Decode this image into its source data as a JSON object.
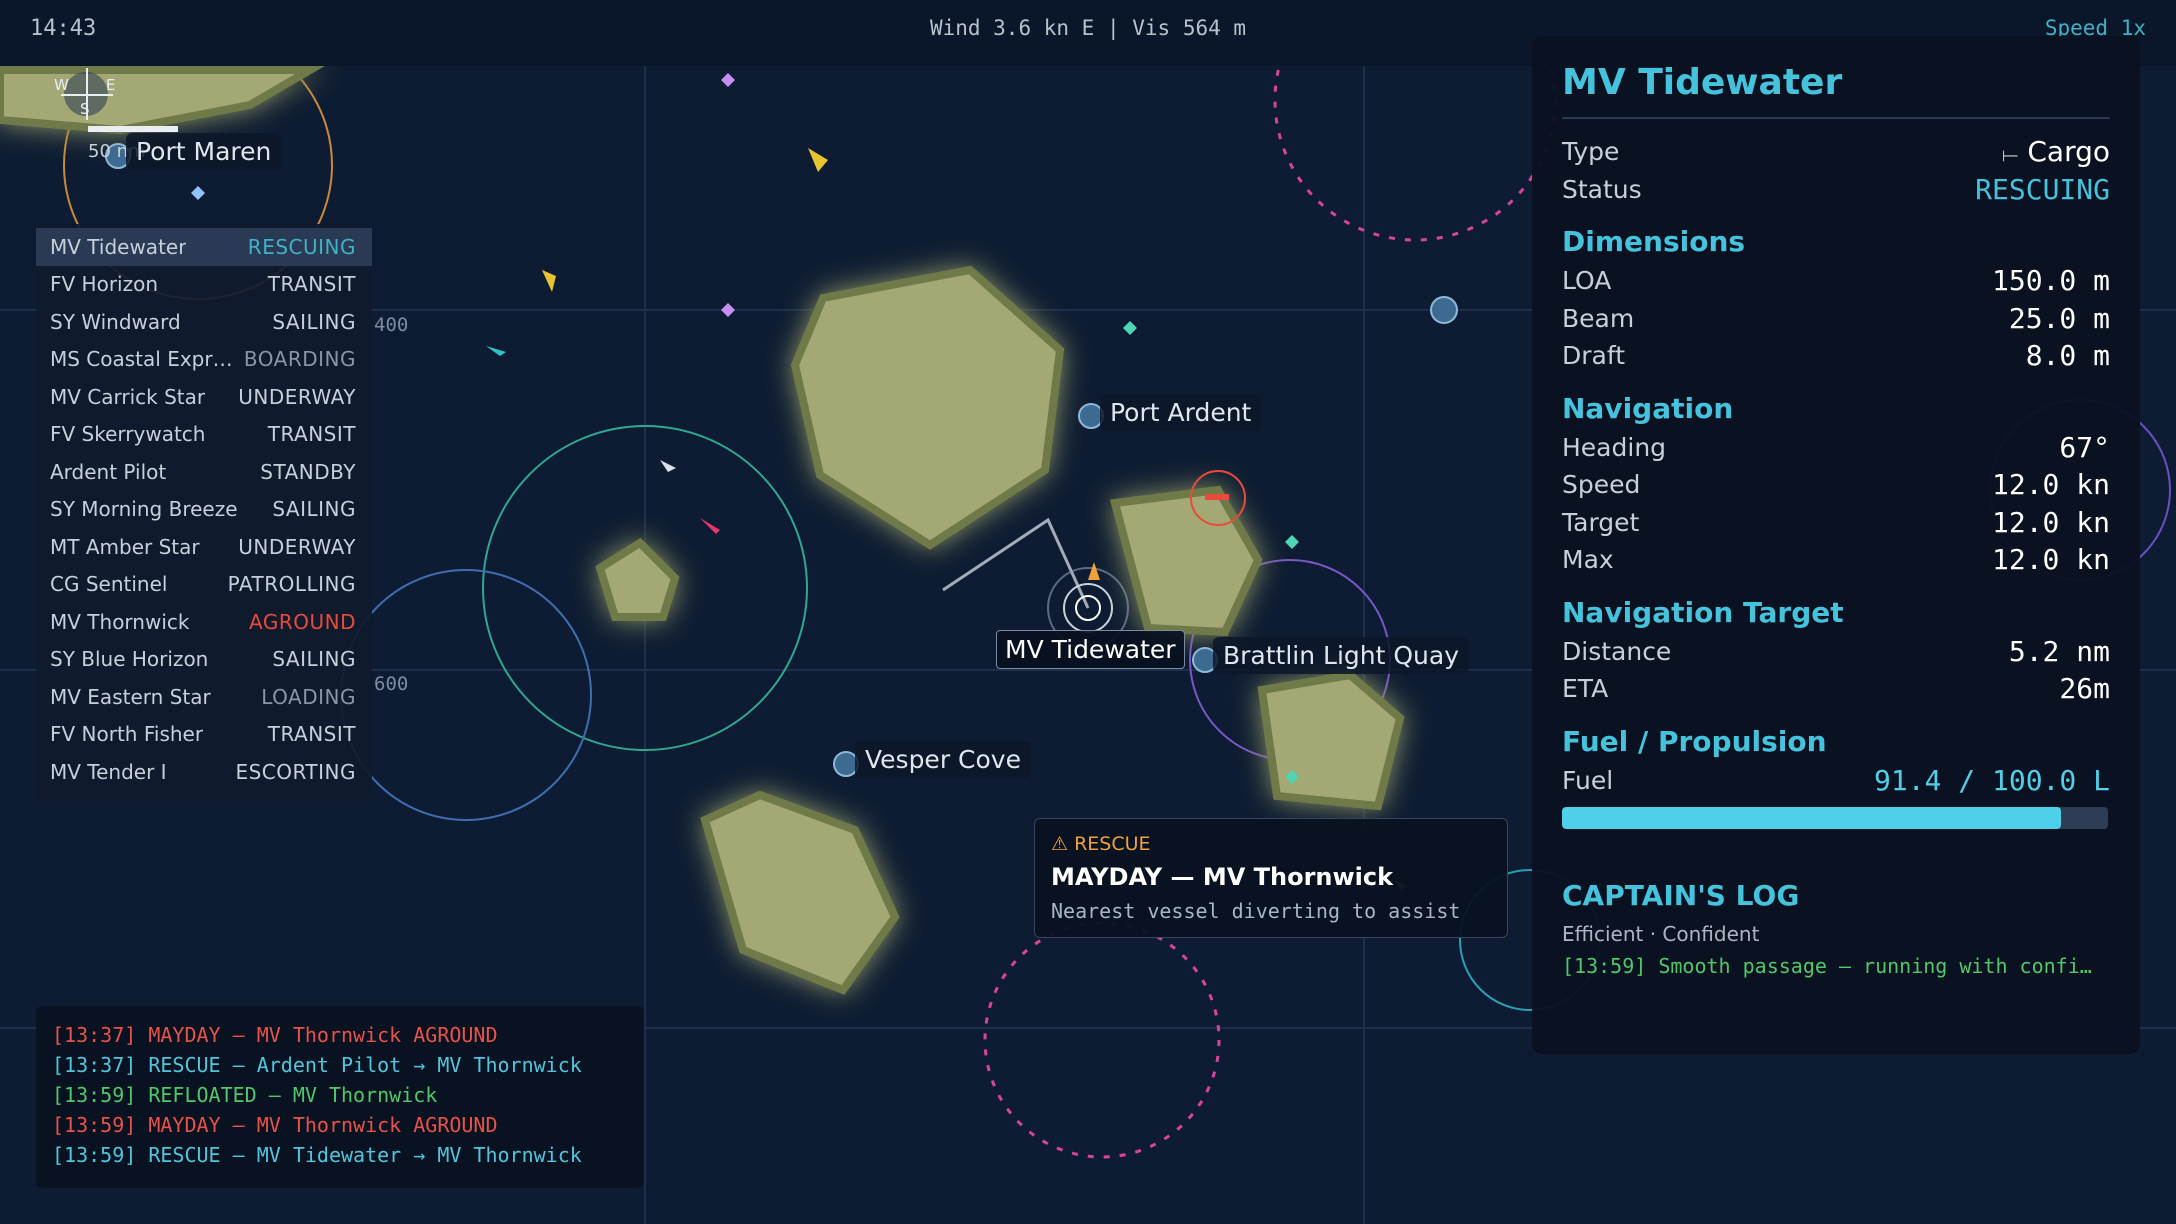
{
  "topbar": {
    "clock": "14:43",
    "weather": "Wind 3.6 kn E | Vis 564 m",
    "speed": "Speed 1x"
  },
  "compass": {
    "w": "W",
    "e": "E",
    "s": "S",
    "scale": "50 nm"
  },
  "grid_labels": [
    "400",
    "600"
  ],
  "ports": [
    "Port Maren",
    "Port Ardent",
    "Brattlin Light Quay",
    "Vesper Cove"
  ],
  "ship_label": "MV Tidewater",
  "vessels": [
    {
      "name": "MV Tidewater",
      "status": "RESCUING",
      "color": "#3fb2c8"
    },
    {
      "name": "FV Horizon",
      "status": "TRANSIT",
      "color": "#c7d0da"
    },
    {
      "name": "SY Windward",
      "status": "SAILING",
      "color": "#c7d0da"
    },
    {
      "name": "MS Coastal Expr…",
      "status": "BOARDING",
      "color": "#8a96a6"
    },
    {
      "name": "MV Carrick Star",
      "status": "UNDERWAY",
      "color": "#c7d0da"
    },
    {
      "name": "FV Skerrywatch",
      "status": "TRANSIT",
      "color": "#c7d0da"
    },
    {
      "name": "Ardent Pilot",
      "status": "STANDBY",
      "color": "#c7d0da"
    },
    {
      "name": "SY Morning Breeze",
      "status": "SAILING",
      "color": "#c7d0da"
    },
    {
      "name": "MT Amber Star",
      "status": "UNDERWAY",
      "color": "#c7d0da"
    },
    {
      "name": "CG Sentinel",
      "status": "PATROLLING",
      "color": "#c7d0da"
    },
    {
      "name": "MV Thornwick",
      "status": "AGROUND",
      "color": "#e84b3c"
    },
    {
      "name": "SY Blue Horizon",
      "status": "SAILING",
      "color": "#c7d0da"
    },
    {
      "name": "MV Eastern Star",
      "status": "LOADING",
      "color": "#8a96a6"
    },
    {
      "name": "FV North Fisher",
      "status": "TRANSIT",
      "color": "#c7d0da"
    },
    {
      "name": "MV Tender I",
      "status": "ESCORTING",
      "color": "#c7d0da"
    }
  ],
  "events": [
    {
      "text": "[13:37] MAYDAY — MV Thornwick AGROUND",
      "color": "#e8524a"
    },
    {
      "text": "[13:37] RESCUE — Ardent Pilot → MV Thornwick",
      "color": "#4fc6de"
    },
    {
      "text": "[13:59] REFLOATED — MV Thornwick",
      "color": "#4ec86a"
    },
    {
      "text": "[13:59] MAYDAY — MV Thornwick AGROUND",
      "color": "#e8524a"
    },
    {
      "text": "[13:59] RESCUE — MV Tidewater → MV Thornwick",
      "color": "#4fc6de"
    }
  ],
  "rescue": {
    "tag": "⚠ RESCUE",
    "title": "MAYDAY — MV Thornwick",
    "subtitle": "Nearest vessel diverting to assist"
  },
  "panel": {
    "title": "MV Tidewater",
    "type_label": "Type",
    "type_icon": "ship-icon",
    "type_value": "Cargo",
    "status_label": "Status",
    "status_value": "RESCUING",
    "dimensions_heading": "Dimensions",
    "loa_label": "LOA",
    "loa_value": "150.0 m",
    "beam_label": "Beam",
    "beam_value": "25.0 m",
    "draft_label": "Draft",
    "draft_value": "8.0 m",
    "navigation_heading": "Navigation",
    "heading_label": "Heading",
    "heading_value": "67°",
    "speed_label": "Speed",
    "speed_value": "12.0 kn",
    "target_label": "Target",
    "target_value": "12.0 kn",
    "max_label": "Max",
    "max_value": "12.0 kn",
    "nav_target_heading": "Navigation Target",
    "distance_label": "Distance",
    "distance_value": "5.2 nm",
    "eta_label": "ETA",
    "eta_value": "26m",
    "fuel_heading": "Fuel / Propulsion",
    "fuel_label": "Fuel",
    "fuel_value": "91.4 / 100.0 L",
    "fuel_fraction": 0.914,
    "log_heading": "CAPTAIN'S LOG",
    "log_traits": "Efficient · Confident",
    "log_entry": "[13:59] Smooth passage — running with confi…"
  },
  "colors": {
    "accent": "#45c3dd",
    "land": "#a3a874",
    "sea": "#0e1c33",
    "alert": "#e84b3c"
  }
}
